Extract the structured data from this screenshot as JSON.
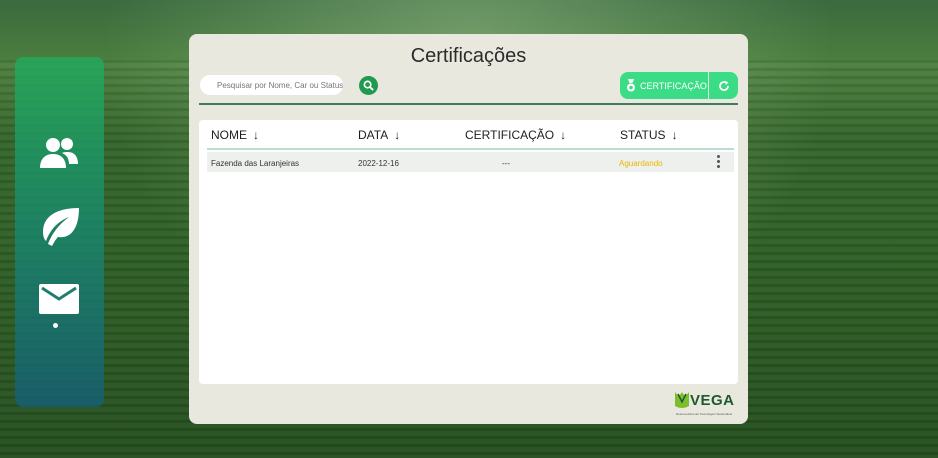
{
  "page": {
    "title": "Certificações"
  },
  "search": {
    "placeholder": "Pesquisar por Nome, Car ou Status"
  },
  "toolbar": {
    "certification_label": "CERTIFICAÇÃO"
  },
  "table": {
    "headers": {
      "name": "NOME",
      "date": "DATA",
      "certification": "CERTIFICAÇÃO",
      "status": "STATUS"
    },
    "sort_arrow": "↓",
    "rows": [
      {
        "name": "Fazenda das Laranjeiras",
        "date": "2022-12-16",
        "certification": "---",
        "status": "Aguardando"
      }
    ]
  },
  "logo": {
    "text": "VEGA",
    "tagline": "Desenvolvimento Tecnológico Sustentável"
  },
  "colors": {
    "accent": "#3bdc86",
    "status_pending": "#e6b800",
    "search_button": "#1f9a4f",
    "divider": "#3f7d5e"
  },
  "icons": {
    "sidebar": [
      "users-icon",
      "leaf-icon",
      "mail-icon"
    ],
    "search": "search-icon",
    "certificate": "medal-icon",
    "refresh": "refresh-icon",
    "more": "kebab-menu-icon"
  }
}
